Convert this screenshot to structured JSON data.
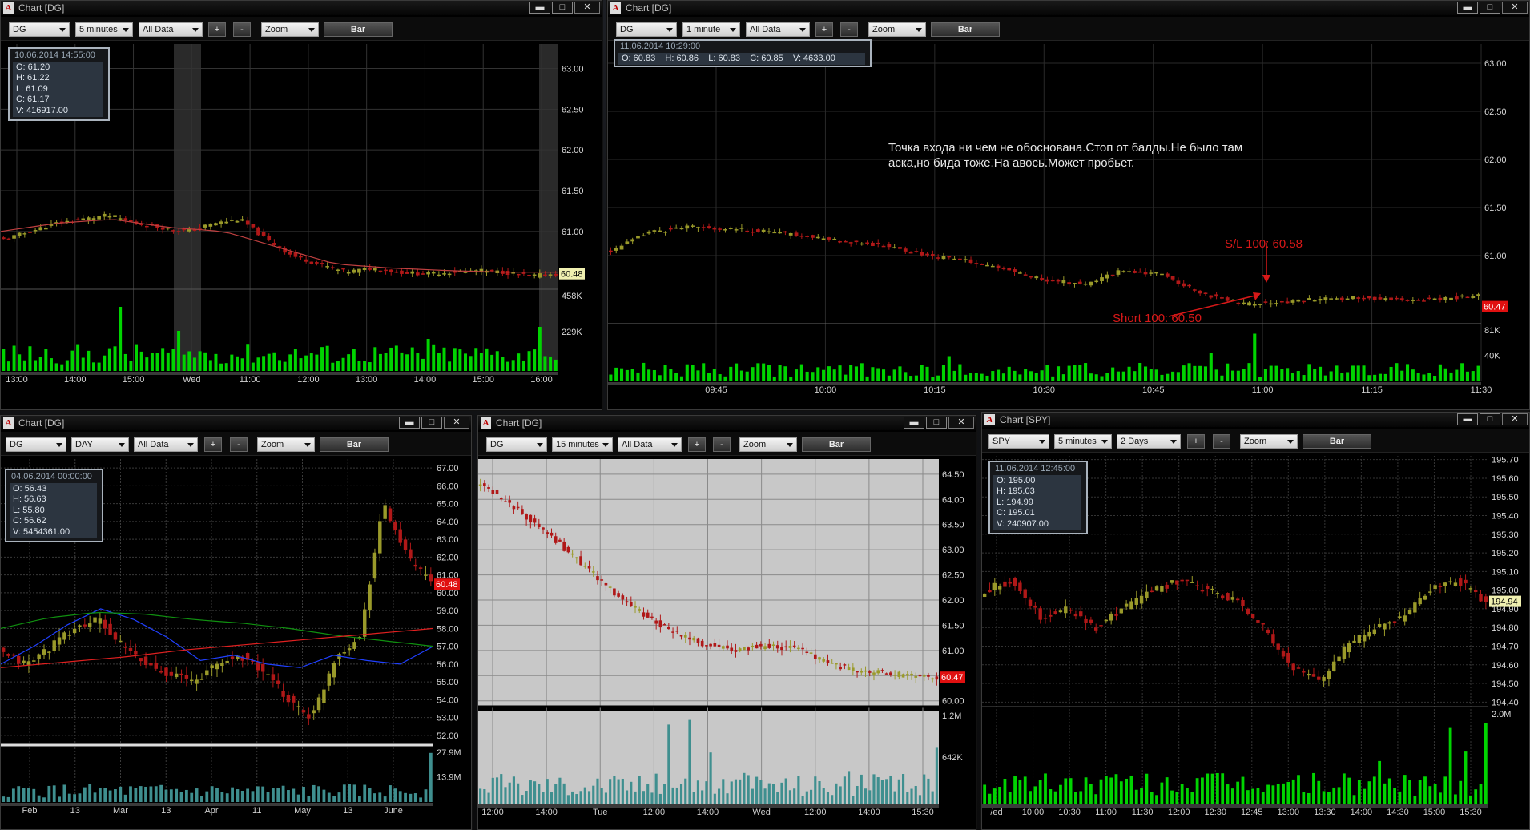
{
  "windows": [
    {
      "id": "w1",
      "title": "Chart [DG]",
      "toolbar": {
        "symbol": "DG",
        "interval": "5 minutes",
        "range": "All Data",
        "plus": "+",
        "minus": "-",
        "zoom": "Zoom",
        "style": "Bar"
      },
      "info": {
        "datetime": "10.06.2014 14:55:00",
        "lines": [
          "O: 61.20",
          "H: 61.22",
          "L: 61.09",
          "C: 61.17",
          "V: 416917.00"
        ]
      },
      "price_axis": [
        "63.00",
        "62.50",
        "62.00",
        "61.50",
        "61.00"
      ],
      "last_price": "60.48",
      "volume_axis": [
        "458K",
        "229K"
      ],
      "time_axis": [
        "13:00",
        "14:00",
        "15:00",
        "Wed",
        "11:00",
        "12:00",
        "13:00",
        "14:00",
        "15:00",
        "16:00"
      ]
    },
    {
      "id": "w2",
      "title": "Chart [DG]",
      "toolbar": {
        "symbol": "DG",
        "interval": "1 minute",
        "range": "All Data",
        "plus": "+",
        "minus": "-",
        "zoom": "Zoom",
        "style": "Bar"
      },
      "info": {
        "datetime": "11.06.2014 10:29:00",
        "inline": "O: 60.83    H: 60.86    L: 60.83    C: 60.85    V: 4633.00"
      },
      "price_axis": [
        "63.00",
        "62.50",
        "62.00",
        "61.50",
        "61.00"
      ],
      "last_price": "60.47",
      "volume_axis": [
        "81K",
        "40K"
      ],
      "time_axis": [
        "09:45",
        "10:00",
        "10:15",
        "10:30",
        "10:45",
        "11:00",
        "11:15",
        "11:30"
      ],
      "annotation": "Точка входа ни чем не обоснована.Стоп от балды.Не было там\nаска,но бида тоже.На авось.Может пробьет.",
      "stop_label": "S/L 100: 60.58",
      "entry_label": "Short 100: 60.50"
    },
    {
      "id": "w3",
      "title": "Chart [DG]",
      "toolbar": {
        "symbol": "DG",
        "interval": "DAY",
        "range": "All Data",
        "plus": "+",
        "minus": "-",
        "zoom": "Zoom",
        "style": "Bar"
      },
      "info": {
        "datetime": "04.06.2014 00:00:00",
        "lines": [
          "O: 56.43",
          "H: 56.63",
          "L: 55.80",
          "C: 56.62",
          "V: 5454361.00"
        ]
      },
      "price_axis": [
        "67.00",
        "66.00",
        "65.00",
        "64.00",
        "63.00",
        "62.00",
        "61.00",
        "60.00",
        "59.00",
        "58.00",
        "57.00",
        "56.00",
        "55.00",
        "54.00",
        "53.00",
        "52.00"
      ],
      "last_price": "60.48",
      "volume_axis": [
        "27.9M",
        "13.9M"
      ],
      "time_axis": [
        "Feb",
        "13",
        "Mar",
        "13",
        "Apr",
        "11",
        "May",
        "13",
        "June"
      ]
    },
    {
      "id": "w4",
      "title": "Chart [DG]",
      "toolbar": {
        "symbol": "DG",
        "interval": "15 minutes",
        "range": "All Data",
        "plus": "+",
        "minus": "-",
        "zoom": "Zoom",
        "style": "Bar"
      },
      "price_axis": [
        "64.50",
        "64.00",
        "63.50",
        "63.00",
        "62.50",
        "62.00",
        "61.50",
        "61.00",
        "60.50",
        "60.00"
      ],
      "last_price": "60.47",
      "volume_axis": [
        "1.2M",
        "642K"
      ],
      "time_axis": [
        "12:00",
        "14:00",
        "Tue",
        "12:00",
        "14:00",
        "Wed",
        "12:00",
        "14:00",
        "15:30"
      ]
    },
    {
      "id": "w5",
      "title": "Chart [SPY]",
      "toolbar": {
        "symbol": "SPY",
        "interval": "5 minutes",
        "range": "2 Days",
        "plus": "+",
        "minus": "-",
        "zoom": "Zoom",
        "style": "Bar"
      },
      "info": {
        "datetime": "11.06.2014 12:45:00",
        "lines": [
          "O: 195.00",
          "H: 195.03",
          "L: 194.99",
          "C: 195.01",
          "V: 240907.00"
        ]
      },
      "price_axis": [
        "195.70",
        "195.60",
        "195.50",
        "195.40",
        "195.30",
        "195.20",
        "195.10",
        "195.00",
        "194.90",
        "194.80",
        "194.70",
        "194.60",
        "194.50",
        "194.40"
      ],
      "last_price": "194.94",
      "volume_axis": [
        "2.0M"
      ],
      "time_axis": [
        "/ed",
        "10:00",
        "10:30",
        "11:00",
        "11:30",
        "12:00",
        "12:30",
        "12:45",
        "13:00",
        "13:30",
        "14:00",
        "14:30",
        "15:00",
        "15:30"
      ]
    }
  ],
  "colors": {
    "up": "#9a9a2a",
    "down": "#b01818",
    "volume": "#00d400",
    "volume_w4": "#3f8f8f",
    "last_badge": "#e01010",
    "w1_badge": "#f0f0b0"
  },
  "chart_data": [
    {
      "type": "bar",
      "title": "Chart [DG] 5 minutes",
      "series": [
        {
          "name": "DG",
          "close": [
            60.9,
            61.0,
            61.1,
            61.15,
            61.2,
            61.1,
            61.05,
            61.0,
            61.1,
            61.15,
            60.9,
            60.7,
            60.6,
            60.5,
            60.55,
            60.5,
            60.48,
            60.5,
            60.52,
            60.5,
            60.45,
            60.48
          ]
        }
      ],
      "ylim": [
        60.3,
        63.3
      ]
    },
    {
      "type": "bar",
      "title": "Chart [DG] 1 minute",
      "series": [
        {
          "name": "DG",
          "close": [
            61.05,
            61.25,
            61.3,
            61.28,
            61.25,
            61.2,
            61.15,
            61.1,
            61.0,
            60.95,
            60.85,
            60.75,
            60.7,
            60.85,
            60.8,
            60.6,
            60.5,
            60.52,
            60.55,
            60.56,
            60.54,
            60.55,
            60.58
          ]
        }
      ],
      "ylim": [
        60.3,
        63.2
      ]
    },
    {
      "type": "bar",
      "title": "Chart [DG] DAY",
      "series": [
        {
          "name": "DG",
          "close": [
            56.5,
            56.0,
            57.0,
            58.0,
            58.5,
            57.0,
            56.0,
            55.5,
            55.0,
            56.0,
            56.5,
            55.5,
            54.0,
            53.0,
            56.5,
            57.5,
            65.0,
            62.0,
            60.48
          ]
        }
      ],
      "ylim": [
        51.5,
        67.5
      ]
    },
    {
      "type": "bar",
      "title": "Chart [DG] 15 minutes",
      "series": [
        {
          "name": "DG",
          "close": [
            64.3,
            63.9,
            63.5,
            63.0,
            62.5,
            62.0,
            61.6,
            61.3,
            61.1,
            61.0,
            61.1,
            61.05,
            60.8,
            60.6,
            60.55,
            60.5,
            60.47
          ]
        }
      ],
      "ylim": [
        59.9,
        64.8
      ]
    },
    {
      "type": "bar",
      "title": "Chart [SPY] 5 minutes",
      "series": [
        {
          "name": "SPY",
          "close": [
            195.0,
            195.05,
            194.85,
            194.9,
            194.8,
            194.9,
            195.0,
            195.05,
            195.0,
            194.95,
            194.8,
            194.6,
            194.5,
            194.7,
            194.8,
            194.85,
            195.0,
            195.05,
            194.94
          ]
        }
      ],
      "ylim": [
        194.38,
        195.72
      ]
    }
  ]
}
